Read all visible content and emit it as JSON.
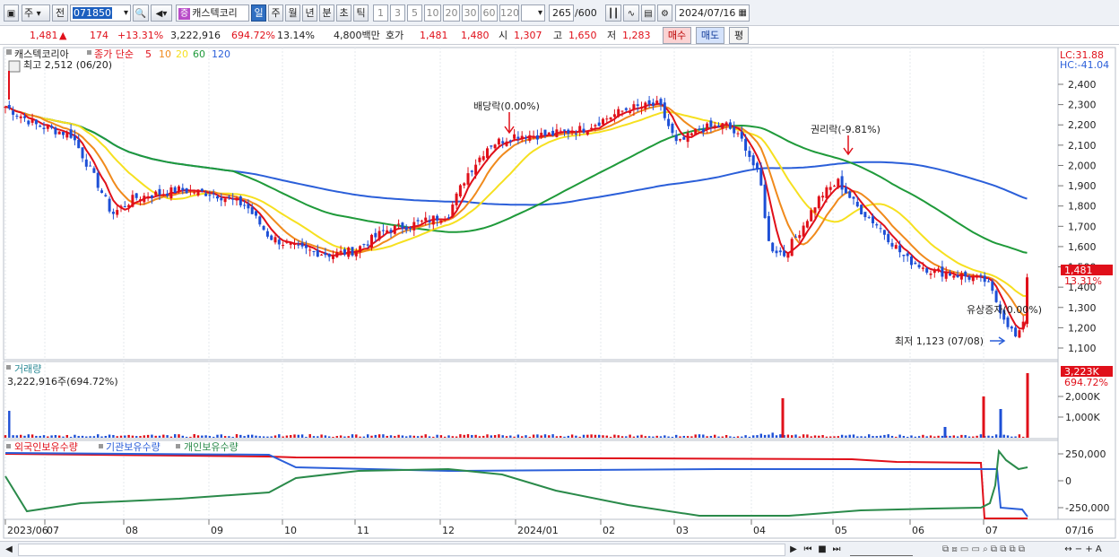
{
  "toolbar": {
    "type_label": "주",
    "prev_label": "전",
    "stock_code": "071850",
    "stock_badge": "증",
    "stock_name": "캐스텍코리",
    "period_day": "일",
    "period_week": "주",
    "period_month": "월",
    "period_year": "년",
    "period_min": "분",
    "period_sec": "초",
    "period_tick": "틱",
    "intervals": [
      "1",
      "3",
      "5",
      "10",
      "20",
      "30",
      "60",
      "120"
    ],
    "count": "265",
    "count_max": "/600",
    "date": "2024/07/16"
  },
  "quote": {
    "price": "1,481",
    "change": "174",
    "change_pct": "+13.31%",
    "volume": "3,222,916",
    "volume_pct": "694.72%",
    "turnover": "13.14%",
    "amount": "4,800백만",
    "bid_label": "호가",
    "bid1": "1,481",
    "bid2": "1,480",
    "open_label": "시",
    "open": "1,307",
    "high_label": "고",
    "high": "1,650",
    "low_label": "저",
    "low": "1,283",
    "buy_label": "매수",
    "sell_label": "매도",
    "eval_label": "평"
  },
  "price_panel": {
    "stock": "캐스텍코리아",
    "ma_label": "종가 단순",
    "ma_periods": [
      "5",
      "10",
      "20",
      "60",
      "120"
    ],
    "high_note": "최고 2,512 (06/20)",
    "low_note": "최저 1,123 (07/08)",
    "dividend_note": "배당락(0.00%)",
    "rights_note": "권리락(-9.81%)",
    "capital_note": "유상증자(0.00%)",
    "lc": "LC:31.88",
    "hc": "HC:-41.04",
    "last_price_tag": "1,481",
    "last_pct_tag": "13.31%",
    "y_ticks": [
      "2,400",
      "2,300",
      "2,200",
      "2,100",
      "2,000",
      "1,900",
      "1,800",
      "1,700",
      "1,600",
      "1,500",
      "1,400",
      "1,300",
      "1,200",
      "1,100"
    ]
  },
  "volume_panel": {
    "title": "거래량",
    "value": "3,222,916주(694.72%)",
    "tag_value": "3,223K",
    "tag_pct": "694.72%",
    "y_ticks": [
      "2,000K",
      "1,000K"
    ]
  },
  "holder_panel": {
    "legend": [
      "외국인보유수량",
      "기관보유수량",
      "개인보유수량"
    ],
    "y_ticks": [
      "250,000",
      "0",
      "-250,000"
    ]
  },
  "x_axis": [
    "2023/06",
    "07",
    "08",
    "09",
    "10",
    "11",
    "12",
    "2024/01",
    "02",
    "03",
    "04",
    "05",
    "06",
    "07"
  ],
  "x_axis_last": "07/16",
  "colors": {
    "up": "#e0101a",
    "down": "#1d4fd6",
    "ma5": "#e0101a",
    "ma10": "#f08a1c",
    "ma20": "#f6e020",
    "ma60": "#1f9a3a",
    "ma120": "#2b5fd9",
    "foreign": "#e0101a",
    "institution": "#2b5fd9",
    "individual": "#2a8a4a"
  }
}
